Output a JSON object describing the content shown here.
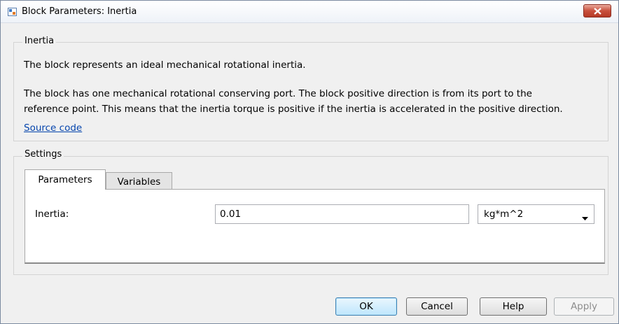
{
  "window": {
    "title": "Block Parameters: Inertia"
  },
  "description_group": {
    "label": "Inertia",
    "line1": "The block represents an ideal mechanical rotational inertia.",
    "line2": "The block has one mechanical rotational conserving port. The block positive direction is from its port to the",
    "line3": "reference point. This means that the inertia torque is positive if the inertia is accelerated in the positive direction.",
    "link": "Source code"
  },
  "settings_group": {
    "label": "Settings",
    "tabs": [
      {
        "label": "Parameters",
        "active": true
      },
      {
        "label": "Variables",
        "active": false
      }
    ],
    "parameters": [
      {
        "label": "Inertia:",
        "value": "0.01",
        "unit": "kg*m^2"
      }
    ]
  },
  "buttons": {
    "ok": "OK",
    "cancel": "Cancel",
    "help": "Help",
    "apply": "Apply"
  },
  "colors": {
    "link": "#0645ad",
    "close_button": "#c9503c"
  },
  "icons": {
    "app": "simulink-block-icon",
    "close": "close-icon",
    "dropdown": "chevron-down-icon"
  }
}
